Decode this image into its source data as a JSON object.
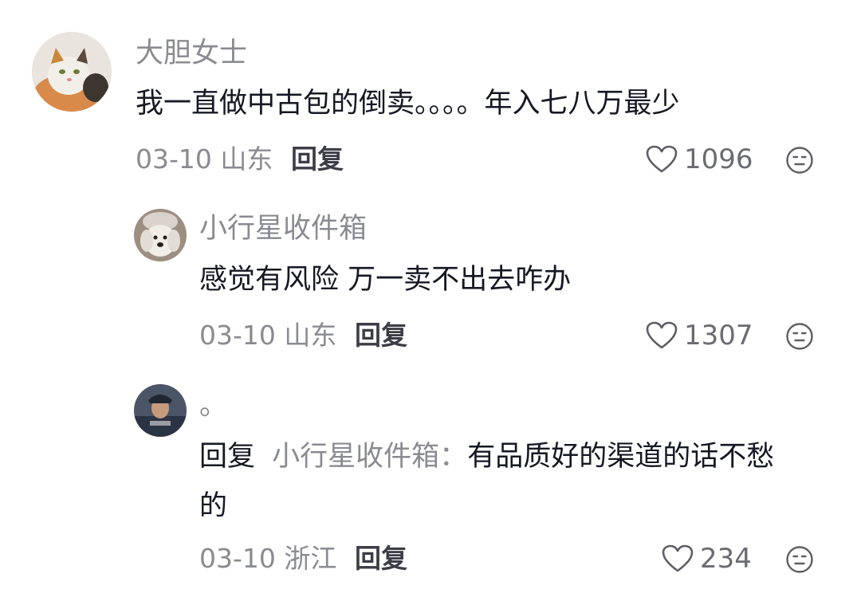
{
  "comments": [
    {
      "username": "大胆女士",
      "text": "我一直做中古包的倒卖。。。。年入七八万最少",
      "date": "03-10",
      "location": "山东",
      "reply_label": "回复",
      "likes": "1096",
      "avatar": "cat-avatar"
    },
    {
      "username": "小行星收件箱",
      "text": "感觉有风险 万一卖不出去咋办",
      "date": "03-10",
      "location": "山东",
      "reply_label": "回复",
      "likes": "1307",
      "avatar": "plush-dog-avatar"
    },
    {
      "username": "。",
      "reply_prefix": "回复",
      "reply_target": "小行星收件箱",
      "reply_colon": "：",
      "text_line1": "有品质好的渠道的话不愁",
      "text_line2": "的",
      "date": "03-10",
      "location": "浙江",
      "reply_label": "回复",
      "likes": "234",
      "avatar": "uniform-person-avatar"
    }
  ],
  "icons": {
    "like": "heart-outline-icon",
    "reaction": "emoji-face-icon"
  }
}
